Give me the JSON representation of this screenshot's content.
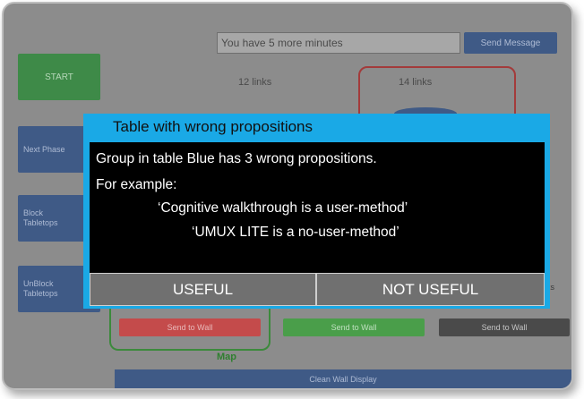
{
  "top": {
    "message_value": "You have 5 more minutes",
    "send_message_label": "Send Message"
  },
  "sidebar": {
    "start_label": "START",
    "next_phase_label": "Next Phase",
    "block_label_1": "Block",
    "block_label_2": "Tabletops",
    "unblock_label_1": "UnBlock",
    "unblock_label_2": "Tabletops"
  },
  "tables": {
    "left_links": "12 links",
    "right_links": "14 links",
    "partial_links": "ks"
  },
  "wall_buttons": {
    "red_label": "Send to Wall",
    "green_label": "Send to Wall",
    "dark_label": "Send to Wall"
  },
  "map_label": "Map",
  "clean_wall_label": "Clean Wall Display",
  "dialog": {
    "title": "Table with wrong propositions",
    "line1": "Group in table Blue has 3 wrong propositions.",
    "line2": "For example:",
    "line3": "‘Cognitive walkthrough is a user-method’",
    "line4": "‘UMUX LITE is a no-user-method’",
    "useful_label": "USEFUL",
    "not_useful_label": "NOT USEFUL"
  },
  "colors": {
    "dialog_border": "#1aa9e6",
    "start_button": "#3e8a48",
    "blue_button": "#3f5a86",
    "red_button": "#c44b4b",
    "green_button": "#4a9e4a",
    "dark_button": "#4a4a4a"
  }
}
